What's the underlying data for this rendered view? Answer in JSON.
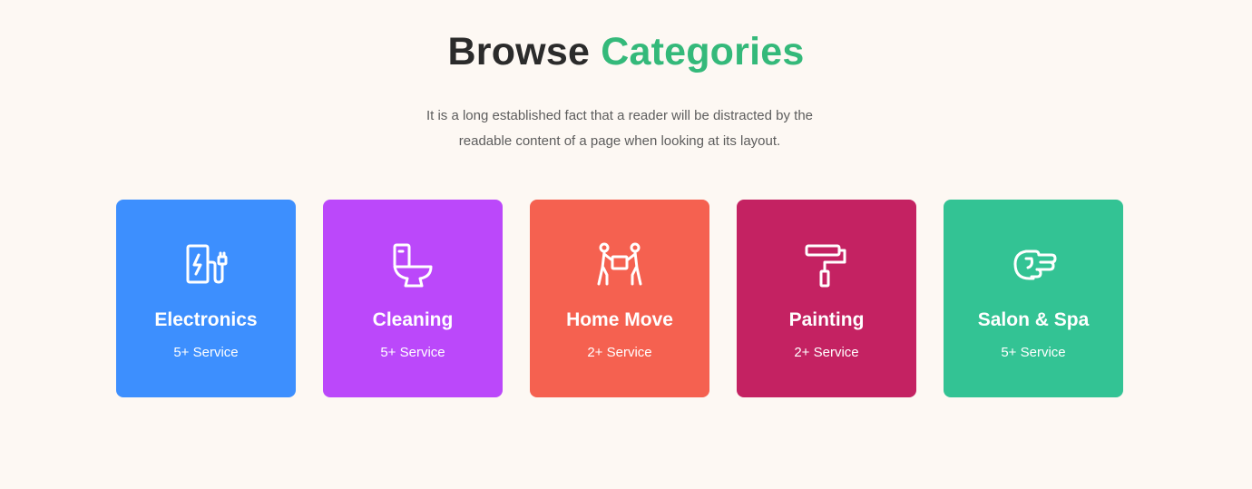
{
  "heading": {
    "part1": "Browse",
    "part2": "Categories",
    "accent_color": "#34b97a"
  },
  "description": "It is a long established fact that a reader will be distracted by the readable content of a page when looking at its layout.",
  "categories": [
    {
      "name": "Electronics",
      "count": "5+ Service",
      "color": "#3d8ffe",
      "icon": "ev-charger-icon"
    },
    {
      "name": "Cleaning",
      "count": "5+ Service",
      "color": "#bb48fa",
      "icon": "toilet-icon"
    },
    {
      "name": "Home Move",
      "count": "2+ Service",
      "color": "#f56150",
      "icon": "movers-carrying-box-icon"
    },
    {
      "name": "Painting",
      "count": "2+ Service",
      "color": "#c42262",
      "icon": "paint-roller-icon"
    },
    {
      "name": "Salon & Spa",
      "count": "5+ Service",
      "color": "#33c394",
      "icon": "hand-pointing-icon"
    }
  ]
}
